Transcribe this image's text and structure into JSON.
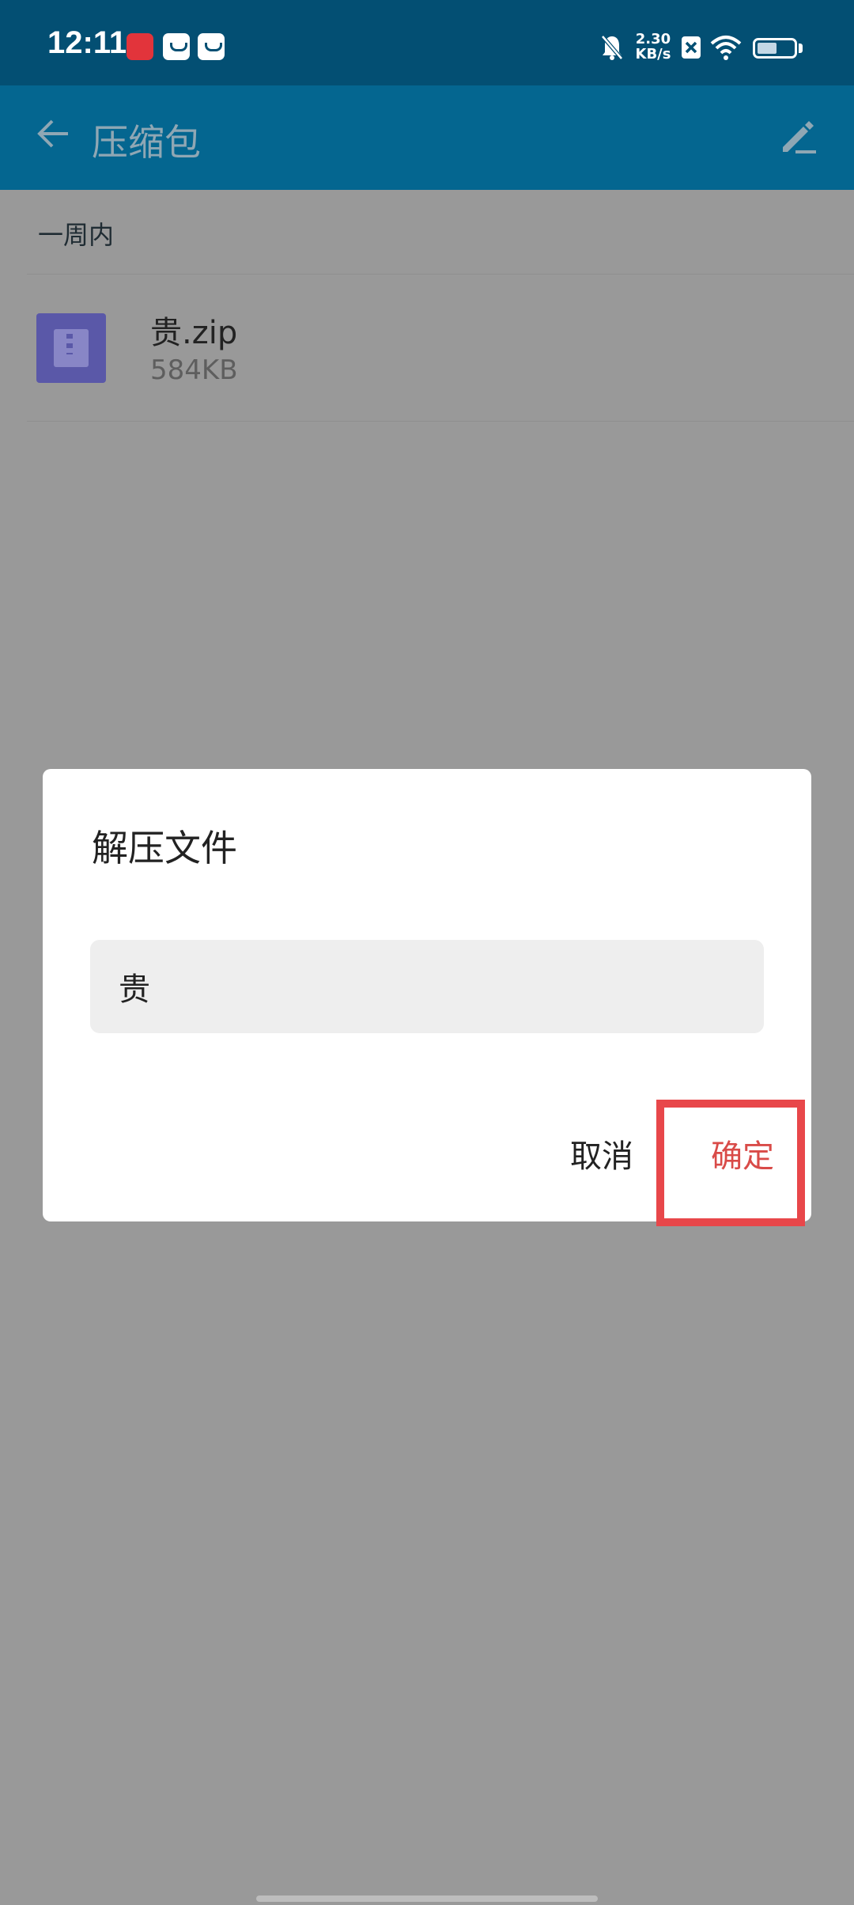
{
  "status_bar": {
    "time": "12:11",
    "net_speed_value": "2.30",
    "net_speed_unit": "KB/s",
    "battery_level": 0.55,
    "icons": [
      "red-app-icon",
      "calendar-icon",
      "mail-icon",
      "bell-muted-icon",
      "sim-off-icon",
      "wifi-icon",
      "battery-icon"
    ]
  },
  "app_bar": {
    "title": "压缩包",
    "back_icon": "back-arrow-icon",
    "edit_icon": "edit-pencil-icon"
  },
  "section": {
    "label": "一周内"
  },
  "files": [
    {
      "name": "贵.zip",
      "size": "584KB",
      "icon": "zip-file-icon"
    }
  ],
  "dialog": {
    "title": "解压文件",
    "input_value": "贵",
    "cancel_label": "取消",
    "confirm_label": "确定"
  },
  "colors": {
    "status_bar": "#034f73",
    "app_bar": "#046690",
    "scrim_background": "#999999",
    "zip_icon": "#5a58a8",
    "confirm_text": "#d94b48",
    "highlight_box": "#e8474a"
  }
}
